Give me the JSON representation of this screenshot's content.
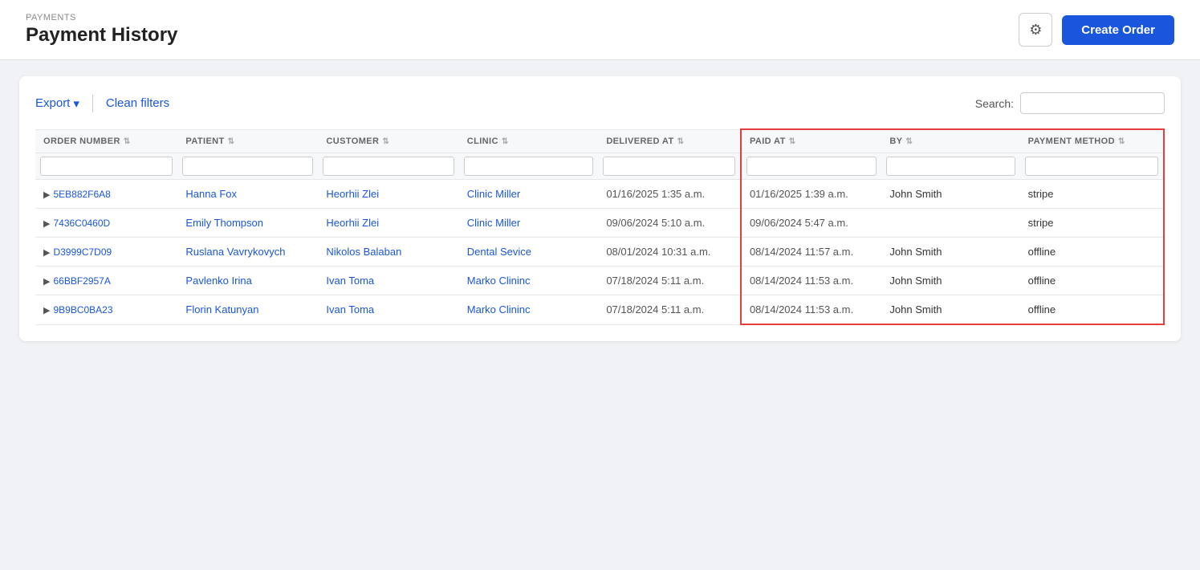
{
  "header": {
    "subtitle": "PAYMENTS",
    "title": "Payment History",
    "gear_label": "⚙",
    "create_order_label": "Create Order"
  },
  "toolbar": {
    "export_label": "Export",
    "export_chevron": "▾",
    "clean_filters_label": "Clean filters",
    "search_label": "Search:",
    "search_placeholder": ""
  },
  "table": {
    "columns": [
      {
        "key": "order_number",
        "label": "ORDER NUMBER"
      },
      {
        "key": "patient",
        "label": "PATIENT"
      },
      {
        "key": "customer",
        "label": "CUSTOMER"
      },
      {
        "key": "clinic",
        "label": "CLINIC"
      },
      {
        "key": "delivered_at",
        "label": "DELIVERED AT"
      },
      {
        "key": "paid_at",
        "label": "PAID AT"
      },
      {
        "key": "by",
        "label": "BY"
      },
      {
        "key": "payment_method",
        "label": "PAYMENT METHOD"
      }
    ],
    "rows": [
      {
        "order_number": "5EB882F6A8",
        "patient": "Hanna Fox",
        "customer": "Heorhii Zlei",
        "clinic": "Clinic Miller",
        "delivered_at": "01/16/2025 1:35 a.m.",
        "paid_at": "01/16/2025 1:39 a.m.",
        "by": "John Smith",
        "payment_method": "stripe"
      },
      {
        "order_number": "7436C0460D",
        "patient": "Emily Thompson",
        "customer": "Heorhii Zlei",
        "clinic": "Clinic Miller",
        "delivered_at": "09/06/2024 5:10 a.m.",
        "paid_at": "09/06/2024 5:47 a.m.",
        "by": "",
        "payment_method": "stripe"
      },
      {
        "order_number": "D3999C7D09",
        "patient": "Ruslana Vavrykovych",
        "customer": "Nikolos Balaban",
        "clinic": "Dental Sevice",
        "delivered_at": "08/01/2024 10:31 a.m.",
        "paid_at": "08/14/2024 11:57 a.m.",
        "by": "John Smith",
        "payment_method": "offline"
      },
      {
        "order_number": "66BBF2957A",
        "patient": "Pavlenko Irina",
        "customer": "Ivan Toma",
        "clinic": "Marko Clininc",
        "delivered_at": "07/18/2024 5:11 a.m.",
        "paid_at": "08/14/2024 11:53 a.m.",
        "by": "John Smith",
        "payment_method": "offline"
      },
      {
        "order_number": "9B9BC0BA23",
        "patient": "Florin Katunyan",
        "customer": "Ivan Toma",
        "clinic": "Marko Clininc",
        "delivered_at": "07/18/2024 5:11 a.m.",
        "paid_at": "08/14/2024 11:53 a.m.",
        "by": "John Smith",
        "payment_method": "offline"
      }
    ]
  }
}
